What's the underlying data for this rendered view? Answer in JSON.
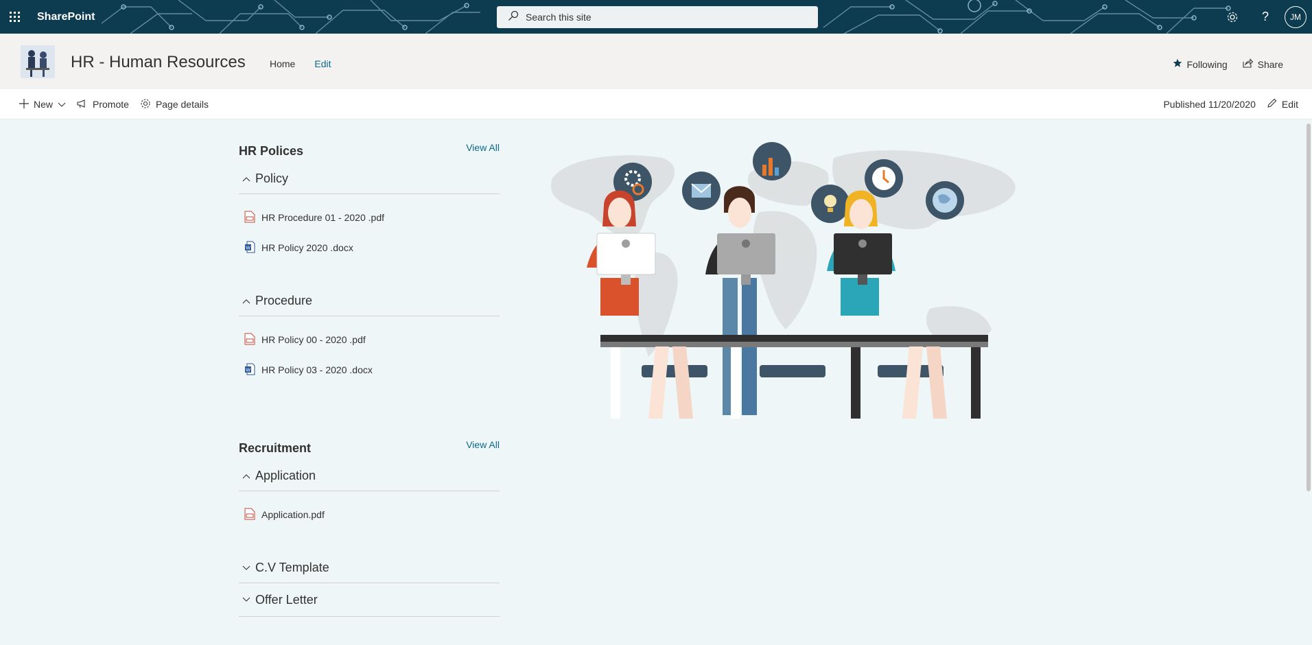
{
  "suitebar": {
    "brand": "SharePoint",
    "search_placeholder": "Search this site",
    "avatar_initials": "JM"
  },
  "site": {
    "title": "HR - Human Resources",
    "nav": {
      "home": "Home",
      "edit": "Edit"
    },
    "following": "Following",
    "share": "Share"
  },
  "commandbar": {
    "new": "New",
    "promote": "Promote",
    "page_details": "Page details",
    "published": "Published 11/20/2020",
    "edit": "Edit"
  },
  "sections": [
    {
      "title": "HR Polices",
      "view_all": "View All",
      "groups": [
        {
          "name": "Policy",
          "files": [
            {
              "name": "HR Procedure 01 - 2020 .pdf",
              "type": "pdf"
            },
            {
              "name": "HR Policy 2020 .docx",
              "type": "docx"
            }
          ]
        },
        {
          "name": "Procedure",
          "files": [
            {
              "name": "HR Policy 00 - 2020 .pdf",
              "type": "pdf"
            },
            {
              "name": "HR Policy 03 - 2020 .docx",
              "type": "docx"
            }
          ]
        }
      ]
    },
    {
      "title": "Recruitment",
      "view_all": "View All",
      "groups": [
        {
          "name": "Application",
          "files": [
            {
              "name": "Application.pdf",
              "type": "pdf"
            }
          ]
        },
        {
          "name": "C.V Template",
          "files": []
        },
        {
          "name": "Offer Letter",
          "files": []
        }
      ]
    }
  ],
  "colors": {
    "suitebar": "#0d3b4f",
    "accent": "#0b6a8a",
    "page_bg": "#eef6f7"
  }
}
